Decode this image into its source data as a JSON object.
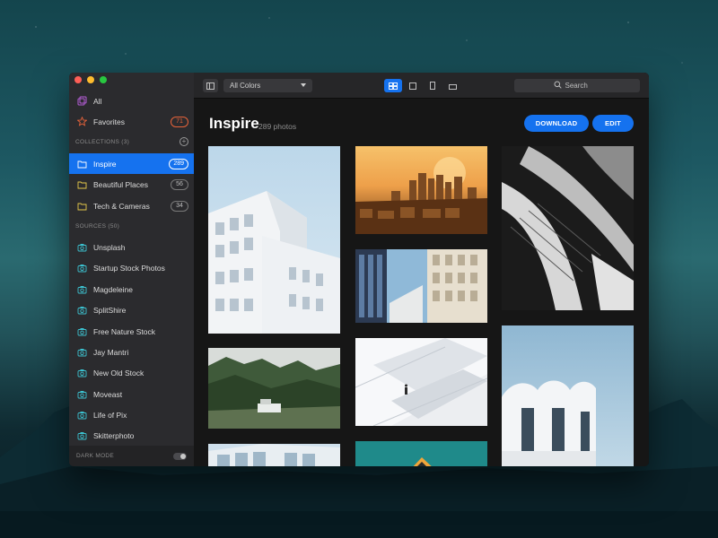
{
  "sidebar": {
    "all_label": "All",
    "favorites_label": "Favorites",
    "favorites_count": "71",
    "collections_header": "COLLECTIONS (3)",
    "collections": [
      {
        "label": "Inspire",
        "count": "289"
      },
      {
        "label": "Beautiful Places",
        "count": "56"
      },
      {
        "label": "Tech & Cameras",
        "count": "34"
      }
    ],
    "sources_header": "SOURCES (50)",
    "sources": [
      {
        "label": "Unsplash"
      },
      {
        "label": "Startup Stock Photos"
      },
      {
        "label": "Magdeleine"
      },
      {
        "label": "SplitShire"
      },
      {
        "label": "Free Nature Stock"
      },
      {
        "label": "Jay Mantri"
      },
      {
        "label": "New Old Stock"
      },
      {
        "label": "Moveast"
      },
      {
        "label": "Life of Pix"
      },
      {
        "label": "Skitterphoto"
      }
    ],
    "dark_mode_label": "DARK MODE"
  },
  "toolbar": {
    "color_filter": "All Colors",
    "search_placeholder": "Search"
  },
  "main": {
    "title": "Inspire",
    "count_label": "289 photos",
    "download_label": "DOWNLOAD",
    "edit_label": "EDIT"
  },
  "colors": {
    "accent": "#1572ef",
    "sidebar_bg": "#2b2b2e",
    "favorites_orange": "#e8633a",
    "folder_yellow": "#e6c84a",
    "source_teal": "#3cc1cf"
  },
  "icons": {
    "all": "all-photos-icon",
    "favorites": "star-icon",
    "collection": "folder-icon",
    "source": "camera-icon",
    "search": "search-icon",
    "add": "plus-icon"
  }
}
